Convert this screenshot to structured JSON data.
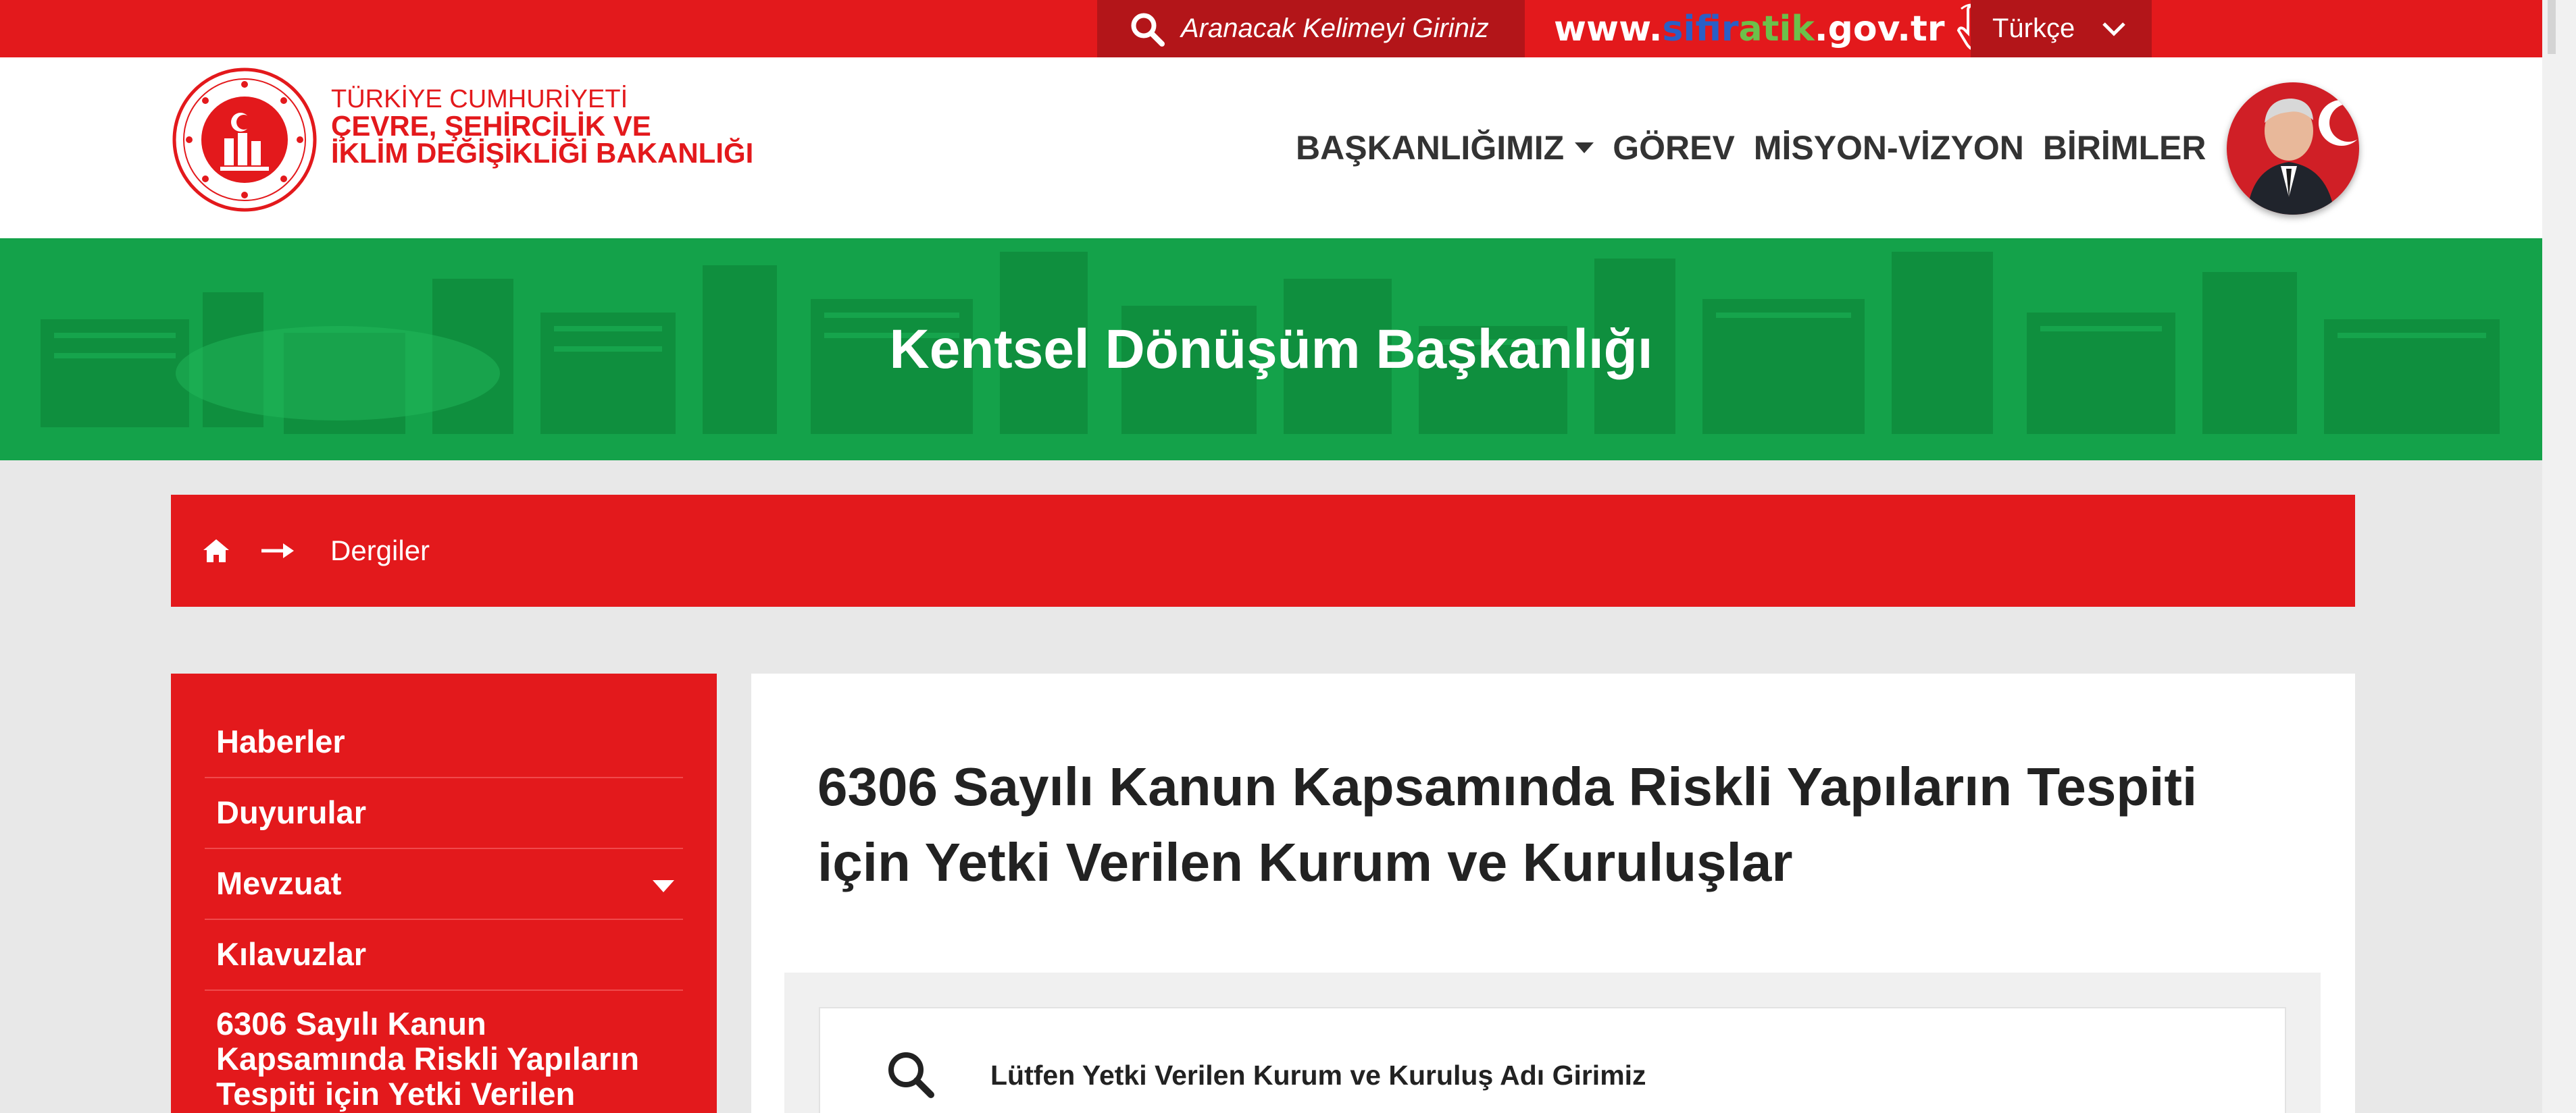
{
  "topbar": {
    "search_placeholder": "Aranacak Kelimeyi Giriniz",
    "sifiratik": {
      "part1": "www.",
      "part2": "sifir",
      "part3": "atik",
      "part4": ".gov.tr"
    },
    "language": "Türkçe"
  },
  "header": {
    "ministry_line1": "TÜRKİYE CUMHURİYETİ",
    "ministry_line2": "ÇEVRE, ŞEHİRCİLİK VE",
    "ministry_line3": "İKLİM DEĞİŞİKLİĞİ BAKANLIĞI",
    "nav": [
      "BAŞKANLIĞIMIZ",
      "GÖREV",
      "MİSYON-VİZYON",
      "BİRİMLER"
    ]
  },
  "hero": {
    "title": "Kentsel Dönüşüm Başkanlığı"
  },
  "breadcrumb": {
    "current": "Dergiler"
  },
  "sidebar": {
    "items": [
      {
        "label": "Haberler"
      },
      {
        "label": "Duyurular"
      },
      {
        "label": "Mevzuat"
      },
      {
        "label": "Kılavuzlar"
      },
      {
        "label_line1": "6306 Sayılı Kanun",
        "label_line2": "Kapsamında Riskli Yapıların",
        "label_line3": "Tespiti için Yetki Verilen"
      }
    ]
  },
  "content": {
    "title_line1": "6306 Sayılı Kanun Kapsamında Riskli Yapıların Tespiti",
    "title_line2": "için Yetki Verilen Kurum ve Kuruluşlar",
    "search_placeholder": "Lütfen Yetki Verilen Kurum ve Kuruluş Adı Girimiz"
  },
  "colors": {
    "brand_red": "#e3191c",
    "dark_red": "#b31519",
    "hero_green": "#14a24a",
    "sifir_blue": "#2a5fc6",
    "sifir_green": "#6cc04a"
  },
  "icons": [
    "search-icon",
    "pointer-hand-icon",
    "chevron-down-icon",
    "ministry-logo",
    "home-icon",
    "arrow-right-icon",
    "caret-down-icon",
    "ataturk-portrait"
  ]
}
